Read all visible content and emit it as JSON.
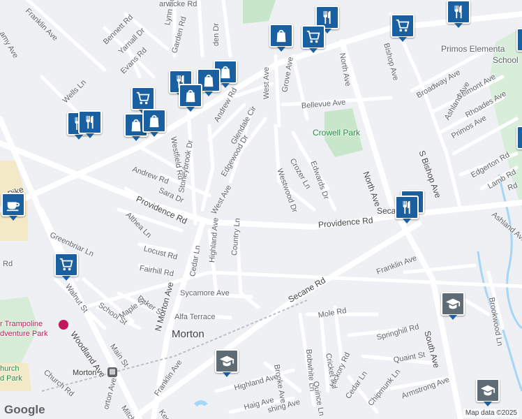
{
  "map": {
    "attribution": "Map data ©2025",
    "logo": "Google",
    "colors": {
      "background": "#eef0f3",
      "road": "#ffffff",
      "park": "#c8e6c9",
      "urban": "#f4e9c6",
      "water": "#a6d6f5",
      "pin": "#1a5fa0",
      "school": "#b9c1c8"
    }
  },
  "places": {
    "town": "Morton",
    "park": "Crowell Park",
    "school": "Primos Elementary School",
    "school_line1": "Primos Elementa",
    "school_line2": "School",
    "trampoline_line1": "r Trampoline",
    "trampoline_line2": "dventure Park",
    "church_line1": "hurch",
    "church_line2": "d Park",
    "station": "Morton"
  },
  "streets": {
    "franklin_ave_top": "Franklin Ave",
    "bennett_rd": "Bennett Rd",
    "yarnall_dr": "Yarnall Dr",
    "lynn_rd": "Lynn Rd",
    "garden_rd": "Garden Rd",
    "alden_dr": "den Dr",
    "evans_rd": "Evans Rd",
    "wells_ln": "Wells Ln",
    "west_ave": "West Ave",
    "grove_ave": "Grove Ave",
    "north_ave_top": "North Ave",
    "bishop_ave": "Bishop Ave",
    "broadway_ave": "Broadway Ave",
    "belmont_ave": "Belmont Ave",
    "ashland_ave": "Ashland Ave",
    "rhoades_ave": "Rhoades Ave",
    "primos_ave": "Primos Ave",
    "bellevue_ave": "Bellevue Ave",
    "andrew_rd_top": "Andrew Rd",
    "glendale_cir": "Glendale Cir",
    "westfield_rd": "Westfield Rd",
    "edgewood_dr": "Edgewood Dr",
    "crozer_ln": "Crozer Ln",
    "edwards_dr": "Edwards Dr",
    "westwood_dr": "Westwood Dr",
    "north_ave": "North Ave",
    "s_bishop_ave": "S Bishop Ave",
    "edgerton_rd": "Edgerton Rd",
    "lamb_rd": "Lamb Rd",
    "ashland_ave_2": "Ashland Ave",
    "andrew_rd": "Andrew Rd",
    "sara_dr": "Sara Dr",
    "stoneybrook_dr": "Stoneybrook Dr",
    "west_ave_2": "West Ave",
    "providence_rd_left": "Providence Rd",
    "providence_rd": "Providence Rd",
    "secane_top": "Seca",
    "pike": "e Pike",
    "greenbriar_ln": "Greenbriar Ln",
    "althea_ln": "Althea Ln",
    "locust_rd": "Locust Rd",
    "highland_ave": "Highland Ave",
    "country_ln": "Country Ln",
    "fairhill_rd": "Fairhill Rd",
    "cedar_ln": "Cedar Ln",
    "rd_left": "Rd",
    "walnut_st": "Walnut St",
    "school_st": "School St",
    "baker_st": "Baker St",
    "maple_st": "Maple St",
    "n_morton_ave": "N Morton Ave",
    "sycamore_ave": "Sycamore Ave",
    "alfa_terrace": "Alfa Terrace",
    "secane_rd": "Secane Rd",
    "franklin_ave": "Franklin Ave",
    "woodland_ave": "Woodland Ave",
    "main_st": "Main St",
    "church_rd": "Church Rd",
    "mole_rd": "Mole Rd",
    "brookwood_ln": "Brookwood Ln",
    "south_ave": "South Ave",
    "springhill_rd": "Springhill Rd",
    "quaint_st": "Quaint St",
    "cricket_rd": "Cricket Rd",
    "bobwhite_ln": "Bobwhite Ln",
    "brooke_ave": "Brooke Ave",
    "quince_ln": "Quince Ln",
    "hickory_rd": "Hickory Rd",
    "cedar_ln_2": "Cedar Ln",
    "chipmunk_ln": "Chipmunk Ln",
    "armstrong_ave": "Armstrong Ave",
    "highland_ave_2": "Highland Ave",
    "haig_ave": "Haig Ave",
    "shing_ave": "shing Ave",
    "franklin_ave_bottom": "Franklin Ave",
    "morton_ave_bottom": "orton Ave",
    "mitchell": "Mitchel",
    "ked": "Ked",
    "hawk": "arwicke Rd",
    "amy": "amy Ave",
    "rd_right": "Rd"
  },
  "pins": [
    {
      "kind": "restaurant",
      "icon": "fork-knife-icon"
    },
    {
      "kind": "shopping",
      "icon": "shopping-bag-icon"
    },
    {
      "kind": "grocery",
      "icon": "shopping-cart-icon"
    },
    {
      "kind": "school",
      "icon": "school-cap-icon"
    },
    {
      "kind": "cafe",
      "icon": "coffee-cup-icon"
    }
  ]
}
